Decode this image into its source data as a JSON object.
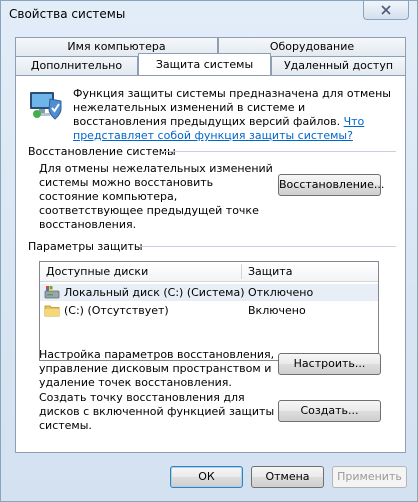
{
  "window": {
    "title": "Свойства системы"
  },
  "tabs": {
    "row_back": [
      "Имя компьютера",
      "Оборудование"
    ],
    "row_front": [
      "Дополнительно",
      "Защита системы",
      "Удаленный доступ"
    ]
  },
  "intro": {
    "text": "Функция защиты системы предназначена для отмены нежелательных изменений в системе и восстановления предыдущих версий файлов.",
    "link": "Что представляет собой функция защиты системы?"
  },
  "restore": {
    "group": "Восстановление системы",
    "description": "Для отмены нежелательных изменений системы можно восстановить состояние компьютера, соответствующее предыдущей точке восстановления.",
    "button": "Восстановление..."
  },
  "protection": {
    "group": "Параметры защиты",
    "columns": [
      "Доступные диски",
      "Защита"
    ],
    "rows": [
      {
        "drive": "Локальный диск (C:) (Система)",
        "status": "Отключено",
        "icon": "system-drive-icon"
      },
      {
        "drive": "(C:) (Отсутствует)",
        "status": "Включено",
        "icon": "folder-drive-icon"
      }
    ],
    "configure_description": "Настройка параметров восстановления, управление дисковым пространством и удаление точек восстановления.",
    "configure_button": "Настроить...",
    "create_description": "Создать точку восстановления для дисков с включенной функцией защиты системы.",
    "create_button": "Создать..."
  },
  "footer": {
    "ok": "ОК",
    "cancel": "Отмена",
    "apply": "Применить"
  }
}
